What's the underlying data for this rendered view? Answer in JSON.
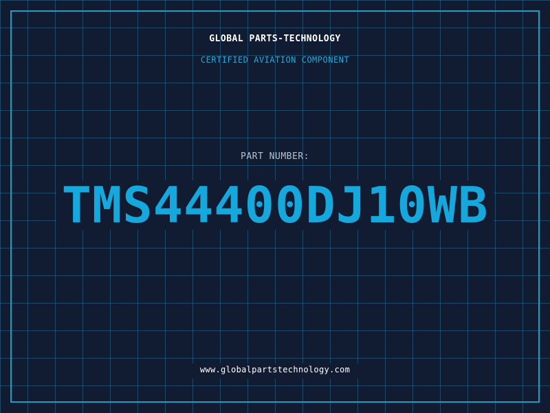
{
  "header": {
    "company": "GLOBAL PARTS-TECHNOLOGY",
    "subtitle": "CERTIFIED AVIATION COMPONENT"
  },
  "part": {
    "label": "PART NUMBER:",
    "number": "TMS44400DJ10WB"
  },
  "footer": {
    "url": "www.globalpartstechnology.com"
  },
  "colors": {
    "background": "#111b31",
    "grid": "#266e96",
    "accent": "#16a7dc",
    "frame": "#1b9dc4",
    "text": "#ffffff",
    "label": "#b8c2cc"
  }
}
